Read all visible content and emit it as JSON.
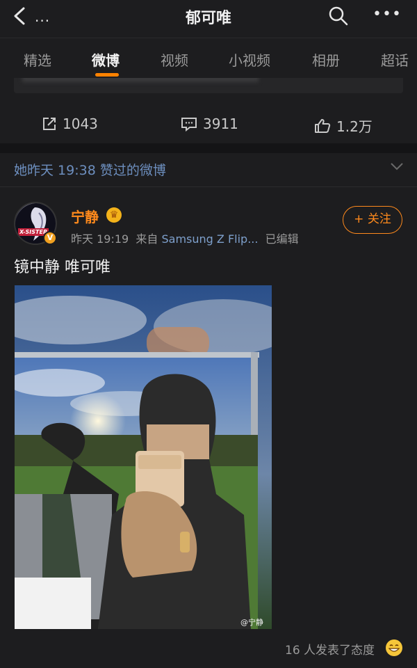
{
  "header": {
    "title": "郁可唯",
    "more_left": "...",
    "back_icon": "chevron-left-icon",
    "search_icon": "search-icon",
    "more_icon": "more-horizontal-icon"
  },
  "tabs": [
    {
      "label": "精选",
      "active": false
    },
    {
      "label": "微博",
      "active": true
    },
    {
      "label": "视频",
      "active": false
    },
    {
      "label": "小视频",
      "active": false
    },
    {
      "label": "相册",
      "active": false
    },
    {
      "label": "超话",
      "active": false
    }
  ],
  "accent_color": "#ff8200",
  "prev_post_actions": {
    "repost": "1043",
    "comment": "3911",
    "like": "1.2万"
  },
  "liked_banner": "她昨天 19:38 赞过的微博",
  "post": {
    "author": "宁静",
    "avatar_text": "X-SISTER",
    "verified_badge": "V",
    "time": "昨天 19:19",
    "source_prefix": "来自",
    "source": "Samsung Z Flip...",
    "edited": "已编辑",
    "follow_label": "+ 关注",
    "text": "镜中静  唯可唯",
    "watermark": "@宁静",
    "reactions": "16 人发表了态度"
  }
}
